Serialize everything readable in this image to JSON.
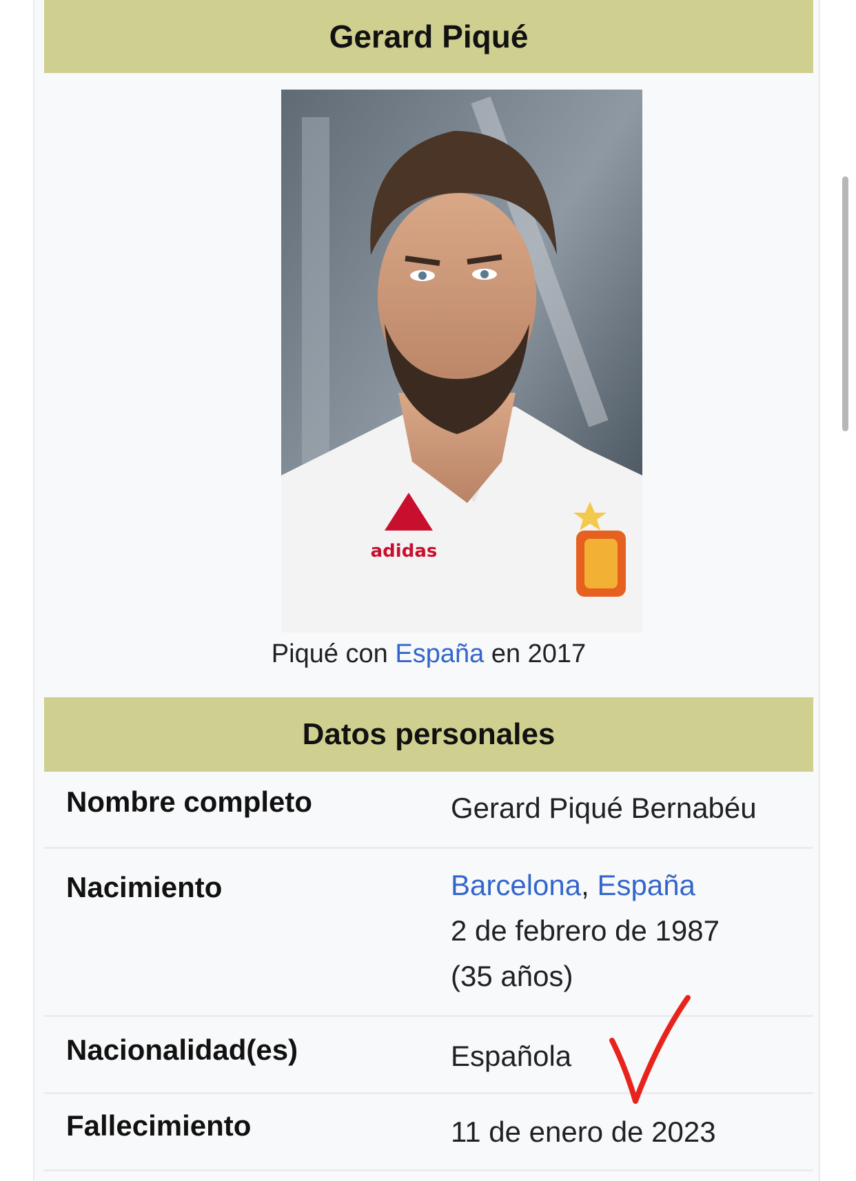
{
  "infobox": {
    "title": "Gerard Piqué",
    "caption": {
      "prefix": "Piqué con ",
      "link": "España",
      "suffix": " en 2017"
    },
    "section_title": "Datos personales",
    "rows": {
      "nombre": {
        "label": "Nombre completo",
        "value": "Gerard Piqué Bernabéu"
      },
      "nacimiento": {
        "label": "Nacimiento",
        "place_city": "Barcelona",
        "place_sep": ", ",
        "place_country": "España",
        "date": "2 de febrero de 1987",
        "age": "(35 años)"
      },
      "nacionalidad": {
        "label": "Nacionalidad(es)",
        "value": "Española"
      },
      "fallecimiento": {
        "label": "Fallecimiento",
        "value": "11 de enero de 2023"
      }
    }
  },
  "photo": {
    "logo_text": "adidas"
  },
  "colors": {
    "header_band": "#cfcf8f",
    "link": "#3366cc",
    "annotation": "#e8231c"
  }
}
